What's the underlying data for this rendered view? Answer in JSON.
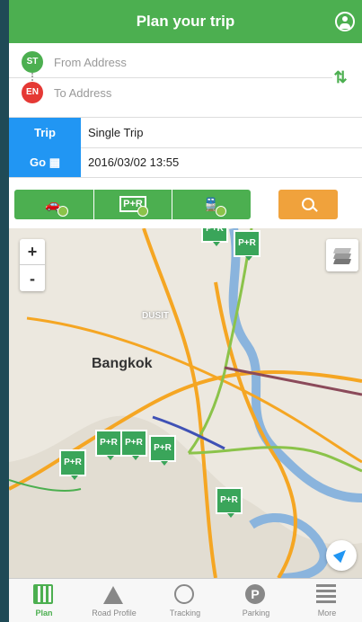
{
  "header": {
    "title": "Plan your trip",
    "account_icon": "account-circle-icon"
  },
  "addresses": {
    "from_badge": "ST",
    "from_placeholder": "From Address",
    "to_badge": "EN",
    "to_placeholder": "To Address",
    "swap_icon": "swap-vertical-icon"
  },
  "trip": {
    "trip_label": "Trip",
    "trip_value": "Single Trip",
    "go_label": "Go",
    "go_icon": "calendar-icon",
    "go_value": "2016/03/02 13:55"
  },
  "modes": [
    {
      "name": "car",
      "icon": "car-icon",
      "selected": true
    },
    {
      "name": "park-and-ride",
      "icon": "park-and-ride-icon",
      "label": "P+R",
      "selected": true
    },
    {
      "name": "train",
      "icon": "train-icon",
      "selected": true
    }
  ],
  "search_icon": "search-icon",
  "map": {
    "zoom_in": "+",
    "zoom_out": "-",
    "city_label": "Bangkok",
    "district_label": "DUSIT",
    "park_ride_label": "P+R"
  },
  "tabs": [
    {
      "label": "Plan",
      "icon": "calculator-icon",
      "active": true
    },
    {
      "label": "Road Profile",
      "icon": "road-icon",
      "active": false
    },
    {
      "label": "Tracking",
      "icon": "play-circle-icon",
      "active": false
    },
    {
      "label": "Parking",
      "icon": "parking-icon",
      "active": false
    },
    {
      "label": "More",
      "icon": "menu-icon",
      "active": false
    }
  ],
  "colors": {
    "primary": "#4caf50",
    "accent": "#2196f3",
    "search": "#f0a23c",
    "danger": "#e53935"
  }
}
